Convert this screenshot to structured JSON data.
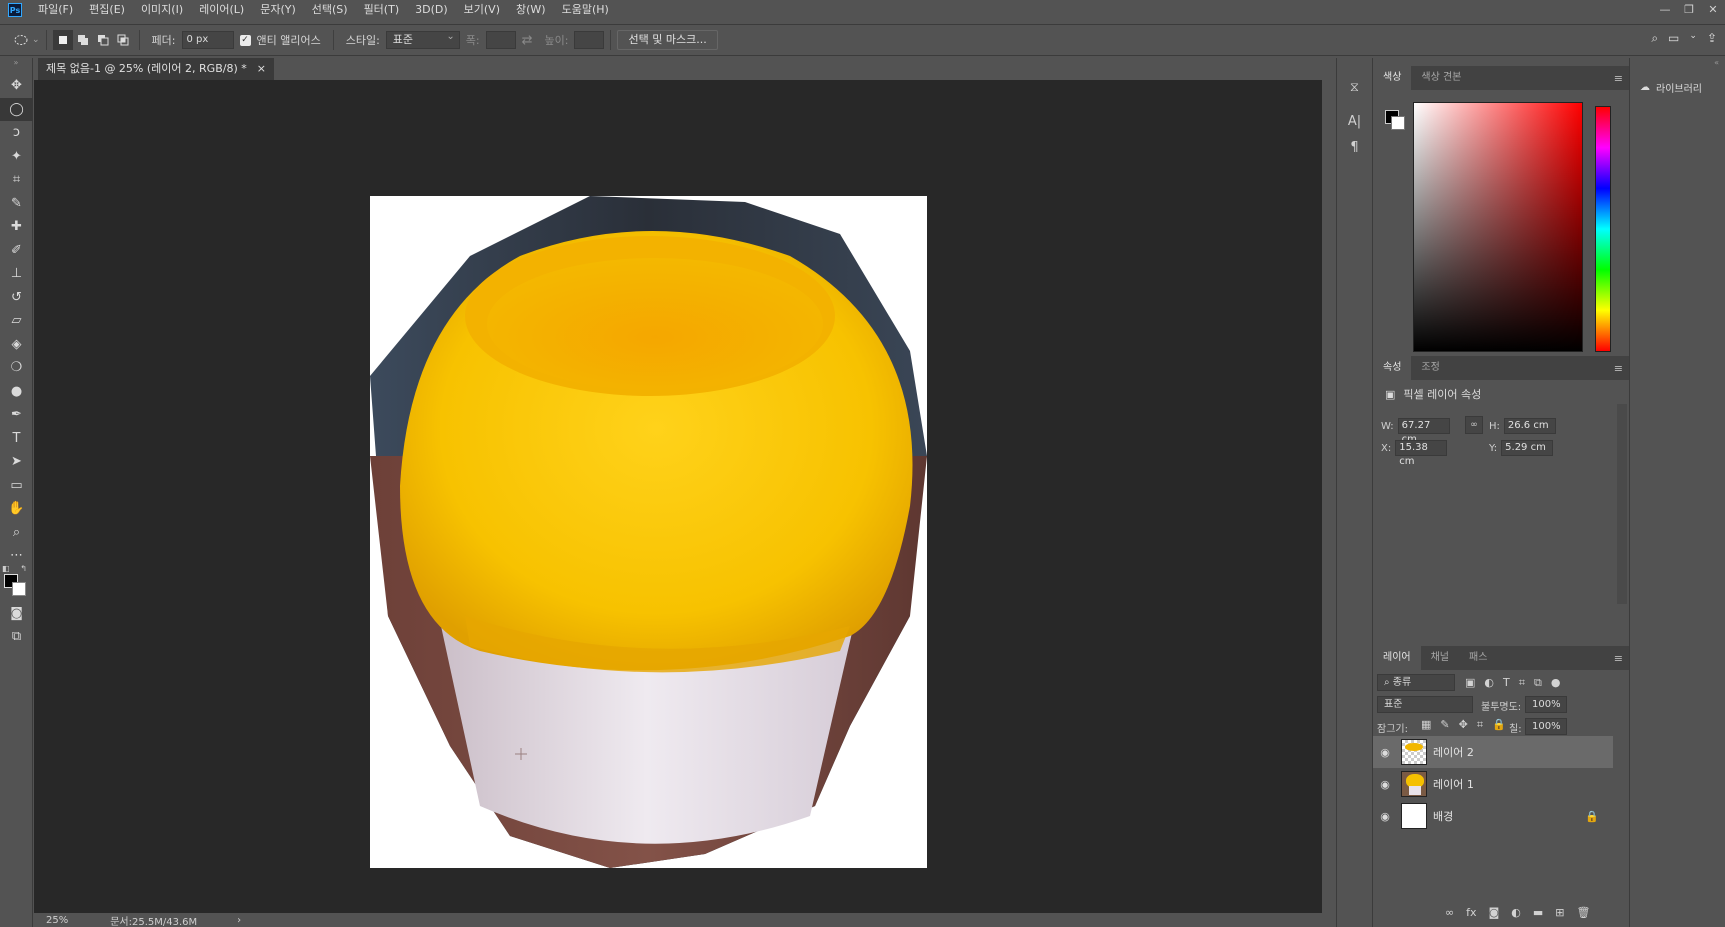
{
  "menubar": {
    "items": [
      "파일(F)",
      "편집(E)",
      "이미지(I)",
      "레이어(L)",
      "문자(Y)",
      "선택(S)",
      "필터(T)",
      "3D(D)",
      "보기(V)",
      "창(W)",
      "도움말(H)"
    ],
    "window_controls": [
      "—",
      "❐",
      "✕"
    ]
  },
  "options": {
    "feather_label": "페더:",
    "feather_value": "0 px",
    "antialias_label": "앤티 앨리어스",
    "style_label": "스타일:",
    "style_value": "표준",
    "width_label": "폭:",
    "height_label": "높이:",
    "select_mask_label": "선택 및 마스크..."
  },
  "document": {
    "tab_title": "제목 없음-1 @ 25% (레이어 2, RGB/8) *",
    "tab_close": "×"
  },
  "status": {
    "zoom": "25%",
    "doc_size": "문서:25.5M/43.6M",
    "arrow": "›"
  },
  "color_panel": {
    "tabs": [
      "색상",
      "색상 견본"
    ]
  },
  "properties_panel": {
    "tabs": [
      "속성",
      "조정"
    ],
    "heading": "픽셀 레이어 속성",
    "w_label": "W:",
    "w_value": "67.27 cm",
    "h_label": "H:",
    "h_value": "26.6 cm",
    "x_label": "X:",
    "x_value": "15.38 cm",
    "y_label": "Y:",
    "y_value": "5.29 cm"
  },
  "layers_panel": {
    "tabs": [
      "레이어",
      "채널",
      "패스"
    ],
    "filter_value": "종류",
    "blend_mode": "표준",
    "opacity_label": "불투명도:",
    "opacity_value": "100%",
    "lock_label": "잠그기:",
    "fill_label": "칠:",
    "fill_value": "100%",
    "layers": [
      {
        "name": "레이어 2",
        "selected": true
      },
      {
        "name": "레이어 1",
        "selected": false
      },
      {
        "name": "배경",
        "selected": false,
        "locked": true
      }
    ]
  },
  "libraries_panel": {
    "title": "라이브러리"
  },
  "colors": {
    "foreground": "#000000",
    "background": "#ffffff",
    "canvas_bg": "#282828",
    "ui_bg": "#535353",
    "accent": "#31a8ff"
  }
}
